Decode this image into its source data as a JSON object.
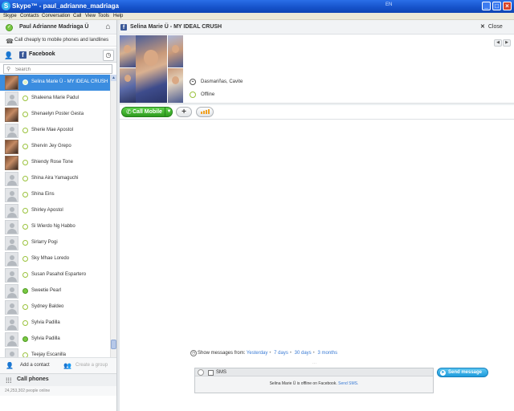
{
  "window": {
    "title": "Skype™ - paul_adrianne_madriaga",
    "app_icon": "S",
    "language": "EN",
    "minimize_glyph": "_",
    "maximize_glyph": "□",
    "close_glyph": "×"
  },
  "menu": [
    "Skype",
    "Contacts",
    "Conversation",
    "Call",
    "View",
    "Tools",
    "Help"
  ],
  "user": {
    "name": "Paul Adrianne Madriaga Ü",
    "status_color": "#7ac943"
  },
  "promo": {
    "text": "Call cheaply to mobile phones and landlines"
  },
  "contacts_tab": {
    "label": "Facebook",
    "fb_glyph": "f"
  },
  "search": {
    "placeholder": "Search"
  },
  "contacts": [
    {
      "name": "Selina Marie Ü - MY IDEAL CRUSH",
      "photo": true,
      "selected": true
    },
    {
      "name": "Shaleena Marie Padul",
      "photo": false
    },
    {
      "name": "Shenaelyn Poster Gesta",
      "photo": true
    },
    {
      "name": "Sherie Mae Apostol",
      "photo": false
    },
    {
      "name": "Shervin Jey Grepo",
      "photo": true
    },
    {
      "name": "Shiendy Rose Tone",
      "photo": true
    },
    {
      "name": "Shina Aira Yamaguchi",
      "photo": false
    },
    {
      "name": "Shina Eins",
      "photo": false
    },
    {
      "name": "Shirley Apostol",
      "photo": false
    },
    {
      "name": "Si Wierdo Ng Habbo",
      "photo": false
    },
    {
      "name": "Sirlarry Pogi",
      "photo": false
    },
    {
      "name": "Sky Mhae Loredo",
      "photo": false
    },
    {
      "name": "Susan Pasahol Espartero",
      "photo": false
    },
    {
      "name": "Sweetie Pearl",
      "photo": false,
      "online": true
    },
    {
      "name": "Sydney Baldeo",
      "photo": false
    },
    {
      "name": "Sylvia Padilla",
      "photo": false
    },
    {
      "name": "Sylvia Padilla",
      "photo": false,
      "online": true
    },
    {
      "name": "Teejay Escanilla",
      "photo": false
    }
  ],
  "bottom": {
    "add_contact": "Add a contact",
    "create_group": "Create a group",
    "call_phones": "Call phones",
    "people_online": "24,253,302 people online"
  },
  "conversation": {
    "fb_glyph": "f",
    "contact_name": "Selina Marie Ü - MY IDEAL CRUSH",
    "close_label": "Close",
    "location": "Dasmariñas, Cavite",
    "status": "Offline",
    "call_mobile_label": "Call Mobile",
    "add_glyph": "+",
    "show_messages_from": "Show messages from:",
    "history_options": [
      "Yesterday",
      "7 days",
      "30 days",
      "3 months"
    ],
    "sms_label": "SMS",
    "offline_notice": "Selina Marie Ü is offline on Facebook.",
    "send_sms_link": "Send SMS.",
    "send_button": "Send message"
  }
}
